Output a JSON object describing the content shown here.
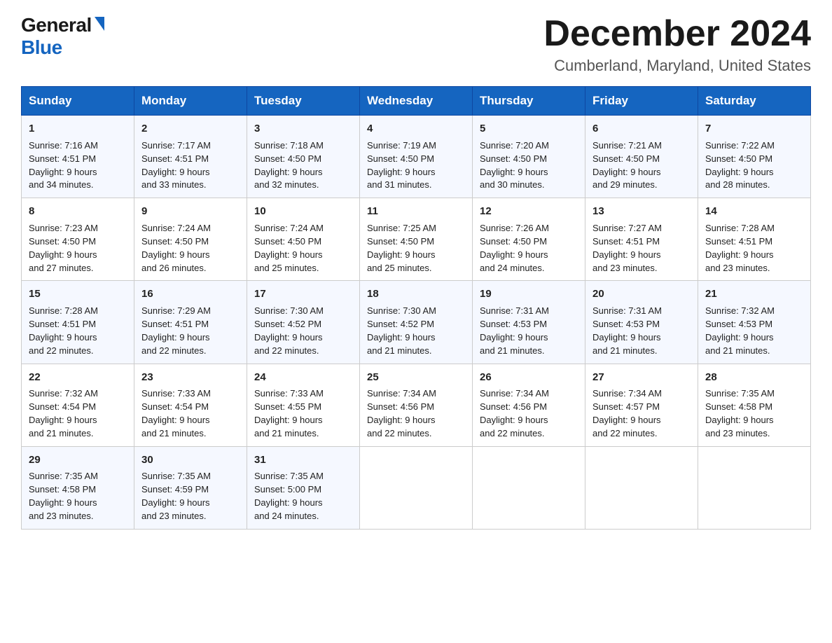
{
  "logo": {
    "general": "General",
    "blue": "Blue"
  },
  "title": "December 2024",
  "location": "Cumberland, Maryland, United States",
  "days_header": [
    "Sunday",
    "Monday",
    "Tuesday",
    "Wednesday",
    "Thursday",
    "Friday",
    "Saturday"
  ],
  "weeks": [
    [
      {
        "day": "1",
        "sunrise": "7:16 AM",
        "sunset": "4:51 PM",
        "daylight": "9 hours and 34 minutes."
      },
      {
        "day": "2",
        "sunrise": "7:17 AM",
        "sunset": "4:51 PM",
        "daylight": "9 hours and 33 minutes."
      },
      {
        "day": "3",
        "sunrise": "7:18 AM",
        "sunset": "4:50 PM",
        "daylight": "9 hours and 32 minutes."
      },
      {
        "day": "4",
        "sunrise": "7:19 AM",
        "sunset": "4:50 PM",
        "daylight": "9 hours and 31 minutes."
      },
      {
        "day": "5",
        "sunrise": "7:20 AM",
        "sunset": "4:50 PM",
        "daylight": "9 hours and 30 minutes."
      },
      {
        "day": "6",
        "sunrise": "7:21 AM",
        "sunset": "4:50 PM",
        "daylight": "9 hours and 29 minutes."
      },
      {
        "day": "7",
        "sunrise": "7:22 AM",
        "sunset": "4:50 PM",
        "daylight": "9 hours and 28 minutes."
      }
    ],
    [
      {
        "day": "8",
        "sunrise": "7:23 AM",
        "sunset": "4:50 PM",
        "daylight": "9 hours and 27 minutes."
      },
      {
        "day": "9",
        "sunrise": "7:24 AM",
        "sunset": "4:50 PM",
        "daylight": "9 hours and 26 minutes."
      },
      {
        "day": "10",
        "sunrise": "7:24 AM",
        "sunset": "4:50 PM",
        "daylight": "9 hours and 25 minutes."
      },
      {
        "day": "11",
        "sunrise": "7:25 AM",
        "sunset": "4:50 PM",
        "daylight": "9 hours and 25 minutes."
      },
      {
        "day": "12",
        "sunrise": "7:26 AM",
        "sunset": "4:50 PM",
        "daylight": "9 hours and 24 minutes."
      },
      {
        "day": "13",
        "sunrise": "7:27 AM",
        "sunset": "4:51 PM",
        "daylight": "9 hours and 23 minutes."
      },
      {
        "day": "14",
        "sunrise": "7:28 AM",
        "sunset": "4:51 PM",
        "daylight": "9 hours and 23 minutes."
      }
    ],
    [
      {
        "day": "15",
        "sunrise": "7:28 AM",
        "sunset": "4:51 PM",
        "daylight": "9 hours and 22 minutes."
      },
      {
        "day": "16",
        "sunrise": "7:29 AM",
        "sunset": "4:51 PM",
        "daylight": "9 hours and 22 minutes."
      },
      {
        "day": "17",
        "sunrise": "7:30 AM",
        "sunset": "4:52 PM",
        "daylight": "9 hours and 22 minutes."
      },
      {
        "day": "18",
        "sunrise": "7:30 AM",
        "sunset": "4:52 PM",
        "daylight": "9 hours and 21 minutes."
      },
      {
        "day": "19",
        "sunrise": "7:31 AM",
        "sunset": "4:53 PM",
        "daylight": "9 hours and 21 minutes."
      },
      {
        "day": "20",
        "sunrise": "7:31 AM",
        "sunset": "4:53 PM",
        "daylight": "9 hours and 21 minutes."
      },
      {
        "day": "21",
        "sunrise": "7:32 AM",
        "sunset": "4:53 PM",
        "daylight": "9 hours and 21 minutes."
      }
    ],
    [
      {
        "day": "22",
        "sunrise": "7:32 AM",
        "sunset": "4:54 PM",
        "daylight": "9 hours and 21 minutes."
      },
      {
        "day": "23",
        "sunrise": "7:33 AM",
        "sunset": "4:54 PM",
        "daylight": "9 hours and 21 minutes."
      },
      {
        "day": "24",
        "sunrise": "7:33 AM",
        "sunset": "4:55 PM",
        "daylight": "9 hours and 21 minutes."
      },
      {
        "day": "25",
        "sunrise": "7:34 AM",
        "sunset": "4:56 PM",
        "daylight": "9 hours and 22 minutes."
      },
      {
        "day": "26",
        "sunrise": "7:34 AM",
        "sunset": "4:56 PM",
        "daylight": "9 hours and 22 minutes."
      },
      {
        "day": "27",
        "sunrise": "7:34 AM",
        "sunset": "4:57 PM",
        "daylight": "9 hours and 22 minutes."
      },
      {
        "day": "28",
        "sunrise": "7:35 AM",
        "sunset": "4:58 PM",
        "daylight": "9 hours and 23 minutes."
      }
    ],
    [
      {
        "day": "29",
        "sunrise": "7:35 AM",
        "sunset": "4:58 PM",
        "daylight": "9 hours and 23 minutes."
      },
      {
        "day": "30",
        "sunrise": "7:35 AM",
        "sunset": "4:59 PM",
        "daylight": "9 hours and 23 minutes."
      },
      {
        "day": "31",
        "sunrise": "7:35 AM",
        "sunset": "5:00 PM",
        "daylight": "9 hours and 24 minutes."
      },
      null,
      null,
      null,
      null
    ]
  ],
  "labels": {
    "sunrise": "Sunrise:",
    "sunset": "Sunset:",
    "daylight": "Daylight:"
  }
}
